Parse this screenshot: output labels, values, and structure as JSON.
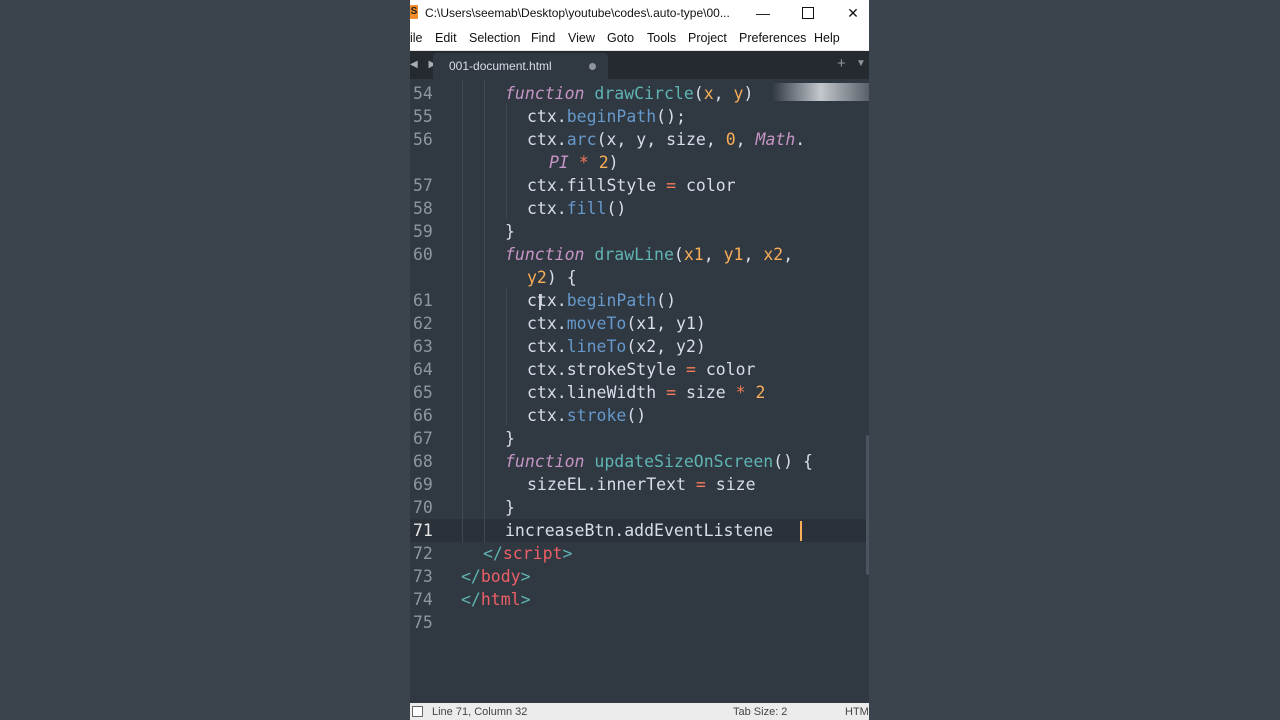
{
  "window": {
    "title": "C:\\Users\\seemab\\Desktop\\youtube\\codes\\.auto-type\\00...",
    "app_icon": "sublime-text-icon",
    "minimize": "—",
    "close": "✕"
  },
  "menu": [
    "ile",
    "Edit",
    "Selection",
    "Find",
    "View",
    "Goto",
    "Tools",
    "Project",
    "Preferences",
    "Help"
  ],
  "tabs": {
    "arrows": "◀ ▶",
    "active": "001-document.html",
    "new_tab": "+",
    "dropdown": "▼"
  },
  "editor": {
    "line_numbers": [
      "54",
      "55",
      "56",
      "",
      "57",
      "58",
      "59",
      "60",
      "",
      "61",
      "62",
      "63",
      "64",
      "65",
      "66",
      "67",
      "68",
      "69",
      "70",
      "71",
      "72",
      "73",
      "74",
      "75"
    ],
    "active_line": "71"
  },
  "status": {
    "position": "Line 71, Column 32",
    "tab_size": "Tab Size: 2",
    "syntax": "HTM"
  },
  "colors": {
    "background": "#303841",
    "keyword": "#c695c6",
    "function_name": "#5fb4b4",
    "parameter": "#f9ae58",
    "method": "#6699cc",
    "tag": "#ec5f66"
  }
}
